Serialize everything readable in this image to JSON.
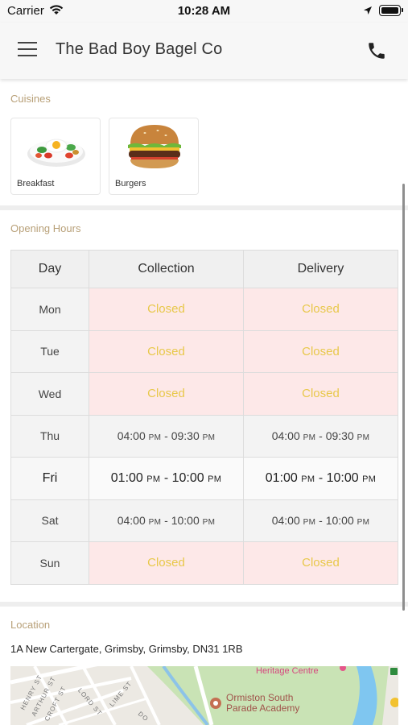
{
  "status_bar": {
    "carrier": "Carrier",
    "time": "10:28 AM"
  },
  "header": {
    "title": "The Bad Boy Bagel Co",
    "menu_icon": "hamburger-menu-icon",
    "phone_icon": "phone-icon"
  },
  "cuisines": {
    "title": "Cuisines",
    "items": [
      {
        "label": "Breakfast",
        "icon": "breakfast-plate-icon"
      },
      {
        "label": "Burgers",
        "icon": "burger-icon"
      }
    ]
  },
  "opening_hours": {
    "title": "Opening Hours",
    "headers": [
      "Day",
      "Collection",
      "Delivery"
    ],
    "am_pm": "PM",
    "rows": [
      {
        "day": "Mon",
        "collection": "Closed",
        "delivery": "Closed"
      },
      {
        "day": "Tue",
        "collection": "Closed",
        "delivery": "Closed"
      },
      {
        "day": "Wed",
        "collection": "Closed",
        "delivery": "Closed"
      },
      {
        "day": "Thu",
        "collection_from": "04:00",
        "collection_to": "09:30",
        "delivery_from": "04:00",
        "delivery_to": "09:30"
      },
      {
        "day": "Fri",
        "collection_from": "01:00",
        "collection_to": "10:00",
        "delivery_from": "01:00",
        "delivery_to": "10:00"
      },
      {
        "day": "Sat",
        "collection_from": "04:00",
        "collection_to": "10:00",
        "delivery_from": "04:00",
        "delivery_to": "10:00"
      },
      {
        "day": "Sun",
        "collection": "Closed",
        "delivery": "Closed"
      }
    ]
  },
  "location": {
    "title": "Location",
    "address": "1A New Cartergate, Grimsby, Grimsby, DN31 1RB",
    "map": {
      "heritage": "Heritage Centre",
      "school_line1": "Ormiston South",
      "school_line2": "Parade Academy",
      "streets": [
        "HENRY ST",
        "ARTHUR ST",
        "CROFT ST",
        "LORD ST",
        "LIME ST",
        "DO"
      ]
    }
  },
  "colors": {
    "section_title": "#b8a078",
    "closed_text": "#e8c84a",
    "closed_bg": "#fde8e8"
  }
}
